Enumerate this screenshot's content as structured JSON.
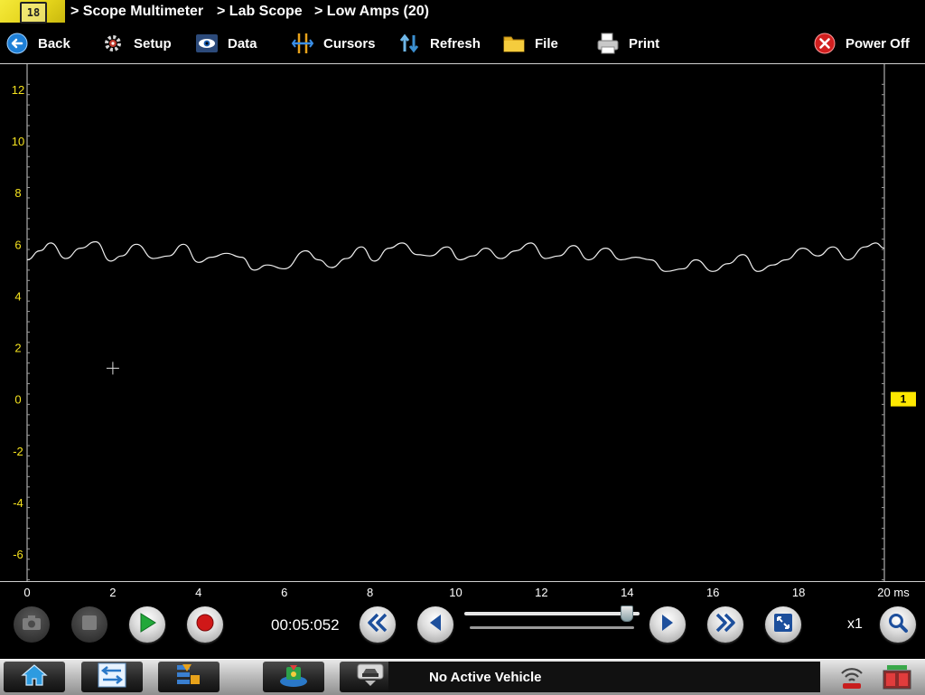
{
  "breadcrumbs": [
    "> Scope Multimeter",
    "> Lab Scope",
    "> Low Amps (20)"
  ],
  "toolbar": {
    "back": "Back",
    "setup": "Setup",
    "data": "Data",
    "cursors": "Cursors",
    "refresh": "Refresh",
    "file": "File",
    "print": "Print",
    "power_off": "Power Off"
  },
  "scope": {
    "y_ticks": [
      "12",
      "10",
      "8",
      "6",
      "4",
      "2",
      "0",
      "-2",
      "-4",
      "-6"
    ],
    "y_range": [
      -7,
      12.5
    ],
    "x_ticks": [
      "0",
      "2",
      "4",
      "6",
      "8",
      "10",
      "12",
      "14",
      "16",
      "18",
      "20 ms"
    ],
    "x_range": [
      0,
      20
    ],
    "channel_marker": "1",
    "trace_color": "#f0f0f0",
    "axis_label_color": "#f5e21f",
    "marker_color": "#ffe800",
    "cursor_crosshair": {
      "x": 2.0,
      "y": 1.2
    },
    "trace": [
      [
        0,
        5.4
      ],
      [
        0.3,
        5.75
      ],
      [
        0.55,
        6.05
      ],
      [
        0.9,
        5.45
      ],
      [
        1.25,
        5.85
      ],
      [
        1.6,
        6.1
      ],
      [
        1.95,
        5.35
      ],
      [
        2.2,
        5.55
      ],
      [
        2.55,
        6.0
      ],
      [
        2.95,
        5.45
      ],
      [
        3.3,
        5.55
      ],
      [
        3.65,
        6.0
      ],
      [
        4.0,
        5.3
      ],
      [
        4.3,
        5.5
      ],
      [
        4.65,
        5.65
      ],
      [
        5.0,
        5.5
      ],
      [
        5.3,
        5.0
      ],
      [
        5.6,
        5.2
      ],
      [
        6.0,
        5.05
      ],
      [
        6.5,
        5.75
      ],
      [
        6.8,
        5.4
      ],
      [
        7.1,
        5.1
      ],
      [
        7.45,
        5.45
      ],
      [
        7.8,
        5.9
      ],
      [
        8.1,
        5.35
      ],
      [
        8.45,
        5.85
      ],
      [
        8.75,
        6.05
      ],
      [
        9.1,
        5.6
      ],
      [
        9.4,
        5.55
      ],
      [
        9.8,
        5.9
      ],
      [
        10.1,
        5.4
      ],
      [
        10.4,
        5.55
      ],
      [
        10.7,
        5.85
      ],
      [
        11.05,
        5.45
      ],
      [
        11.4,
        5.75
      ],
      [
        11.75,
        6.05
      ],
      [
        12.1,
        5.45
      ],
      [
        12.4,
        5.55
      ],
      [
        12.75,
        5.95
      ],
      [
        13.1,
        5.4
      ],
      [
        13.5,
        5.85
      ],
      [
        13.85,
        5.4
      ],
      [
        14.2,
        5.5
      ],
      [
        14.55,
        5.4
      ],
      [
        14.9,
        4.95
      ],
      [
        15.3,
        5.05
      ],
      [
        15.6,
        5.4
      ],
      [
        16.0,
        4.95
      ],
      [
        16.35,
        5.25
      ],
      [
        16.7,
        5.6
      ],
      [
        17.05,
        4.95
      ],
      [
        17.4,
        5.2
      ],
      [
        17.7,
        5.4
      ],
      [
        18.1,
        5.85
      ],
      [
        18.45,
        5.55
      ],
      [
        18.8,
        5.9
      ],
      [
        19.15,
        5.4
      ],
      [
        19.55,
        5.9
      ],
      [
        19.8,
        6.05
      ],
      [
        20.0,
        5.85
      ]
    ]
  },
  "controls": {
    "timestamp": "00:05:052",
    "zoom": "x1",
    "slider_position": 0.93
  },
  "taskbar": {
    "vehicle_status": "No Active Vehicle"
  }
}
